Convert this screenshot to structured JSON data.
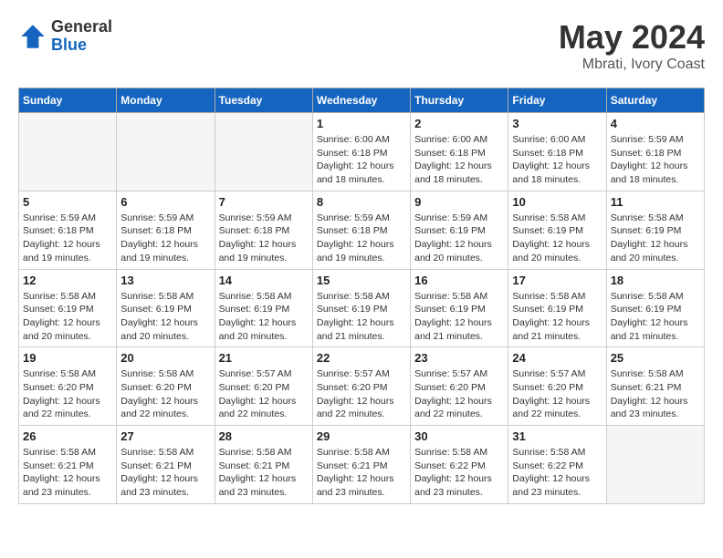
{
  "logo": {
    "general": "General",
    "blue": "Blue"
  },
  "title": "May 2024",
  "subtitle": "Mbrati, Ivory Coast",
  "days_of_week": [
    "Sunday",
    "Monday",
    "Tuesday",
    "Wednesday",
    "Thursday",
    "Friday",
    "Saturday"
  ],
  "weeks": [
    [
      {
        "day": "",
        "info": ""
      },
      {
        "day": "",
        "info": ""
      },
      {
        "day": "",
        "info": ""
      },
      {
        "day": "1",
        "info": "Sunrise: 6:00 AM\nSunset: 6:18 PM\nDaylight: 12 hours and 18 minutes."
      },
      {
        "day": "2",
        "info": "Sunrise: 6:00 AM\nSunset: 6:18 PM\nDaylight: 12 hours and 18 minutes."
      },
      {
        "day": "3",
        "info": "Sunrise: 6:00 AM\nSunset: 6:18 PM\nDaylight: 12 hours and 18 minutes."
      },
      {
        "day": "4",
        "info": "Sunrise: 5:59 AM\nSunset: 6:18 PM\nDaylight: 12 hours and 18 minutes."
      }
    ],
    [
      {
        "day": "5",
        "info": "Sunrise: 5:59 AM\nSunset: 6:18 PM\nDaylight: 12 hours and 19 minutes."
      },
      {
        "day": "6",
        "info": "Sunrise: 5:59 AM\nSunset: 6:18 PM\nDaylight: 12 hours and 19 minutes."
      },
      {
        "day": "7",
        "info": "Sunrise: 5:59 AM\nSunset: 6:18 PM\nDaylight: 12 hours and 19 minutes."
      },
      {
        "day": "8",
        "info": "Sunrise: 5:59 AM\nSunset: 6:18 PM\nDaylight: 12 hours and 19 minutes."
      },
      {
        "day": "9",
        "info": "Sunrise: 5:59 AM\nSunset: 6:19 PM\nDaylight: 12 hours and 20 minutes."
      },
      {
        "day": "10",
        "info": "Sunrise: 5:58 AM\nSunset: 6:19 PM\nDaylight: 12 hours and 20 minutes."
      },
      {
        "day": "11",
        "info": "Sunrise: 5:58 AM\nSunset: 6:19 PM\nDaylight: 12 hours and 20 minutes."
      }
    ],
    [
      {
        "day": "12",
        "info": "Sunrise: 5:58 AM\nSunset: 6:19 PM\nDaylight: 12 hours and 20 minutes."
      },
      {
        "day": "13",
        "info": "Sunrise: 5:58 AM\nSunset: 6:19 PM\nDaylight: 12 hours and 20 minutes."
      },
      {
        "day": "14",
        "info": "Sunrise: 5:58 AM\nSunset: 6:19 PM\nDaylight: 12 hours and 20 minutes."
      },
      {
        "day": "15",
        "info": "Sunrise: 5:58 AM\nSunset: 6:19 PM\nDaylight: 12 hours and 21 minutes."
      },
      {
        "day": "16",
        "info": "Sunrise: 5:58 AM\nSunset: 6:19 PM\nDaylight: 12 hours and 21 minutes."
      },
      {
        "day": "17",
        "info": "Sunrise: 5:58 AM\nSunset: 6:19 PM\nDaylight: 12 hours and 21 minutes."
      },
      {
        "day": "18",
        "info": "Sunrise: 5:58 AM\nSunset: 6:19 PM\nDaylight: 12 hours and 21 minutes."
      }
    ],
    [
      {
        "day": "19",
        "info": "Sunrise: 5:58 AM\nSunset: 6:20 PM\nDaylight: 12 hours and 22 minutes."
      },
      {
        "day": "20",
        "info": "Sunrise: 5:58 AM\nSunset: 6:20 PM\nDaylight: 12 hours and 22 minutes."
      },
      {
        "day": "21",
        "info": "Sunrise: 5:57 AM\nSunset: 6:20 PM\nDaylight: 12 hours and 22 minutes."
      },
      {
        "day": "22",
        "info": "Sunrise: 5:57 AM\nSunset: 6:20 PM\nDaylight: 12 hours and 22 minutes."
      },
      {
        "day": "23",
        "info": "Sunrise: 5:57 AM\nSunset: 6:20 PM\nDaylight: 12 hours and 22 minutes."
      },
      {
        "day": "24",
        "info": "Sunrise: 5:57 AM\nSunset: 6:20 PM\nDaylight: 12 hours and 22 minutes."
      },
      {
        "day": "25",
        "info": "Sunrise: 5:58 AM\nSunset: 6:21 PM\nDaylight: 12 hours and 23 minutes."
      }
    ],
    [
      {
        "day": "26",
        "info": "Sunrise: 5:58 AM\nSunset: 6:21 PM\nDaylight: 12 hours and 23 minutes."
      },
      {
        "day": "27",
        "info": "Sunrise: 5:58 AM\nSunset: 6:21 PM\nDaylight: 12 hours and 23 minutes."
      },
      {
        "day": "28",
        "info": "Sunrise: 5:58 AM\nSunset: 6:21 PM\nDaylight: 12 hours and 23 minutes."
      },
      {
        "day": "29",
        "info": "Sunrise: 5:58 AM\nSunset: 6:21 PM\nDaylight: 12 hours and 23 minutes."
      },
      {
        "day": "30",
        "info": "Sunrise: 5:58 AM\nSunset: 6:22 PM\nDaylight: 12 hours and 23 minutes."
      },
      {
        "day": "31",
        "info": "Sunrise: 5:58 AM\nSunset: 6:22 PM\nDaylight: 12 hours and 23 minutes."
      },
      {
        "day": "",
        "info": ""
      }
    ]
  ]
}
